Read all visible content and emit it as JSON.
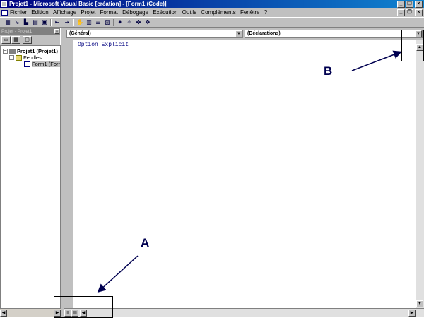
{
  "window": {
    "title": "Projet1 - Microsoft Visual Basic [création] - [Form1 (Code)]",
    "caption_buttons": [
      "_",
      "❐",
      "×"
    ],
    "doc_buttons": [
      "_",
      "❐",
      "×"
    ]
  },
  "menubar": {
    "items": [
      "Fichier",
      "Edition",
      "Affichage",
      "Projet",
      "Format",
      "Débogage",
      "Exécution",
      "Outils",
      "Compléments",
      "Fenêtre",
      "?"
    ]
  },
  "toolbar": {
    "icons": [
      "form-icon",
      "add-icon",
      "editor-icon",
      "menu-icon",
      "open-icon",
      "save-icon",
      "cut-icon",
      "copy-icon",
      "paste-icon",
      "find-icon",
      "undo-icon",
      "redo-icon",
      "run-icon",
      "pause-icon",
      "stop-icon",
      "explorer-icon",
      "properties-icon",
      "designer-icon",
      "toolbox-icon"
    ]
  },
  "project_panel": {
    "title": "Projet - Projet1",
    "close": "×",
    "tree": {
      "root": "Projet1 (Projet1)",
      "folder": "Feuilles",
      "item": "Form1 (Form"
    }
  },
  "code_window": {
    "object_combo": "(Général)",
    "procedure_combo": "(Déclarations)",
    "code_line": "Option Explicit"
  },
  "annotations": {
    "label_a": "A",
    "label_b": "B"
  },
  "colors": {
    "titlebar": "#000080",
    "code_text": "#000080",
    "annotation": "#000050"
  }
}
